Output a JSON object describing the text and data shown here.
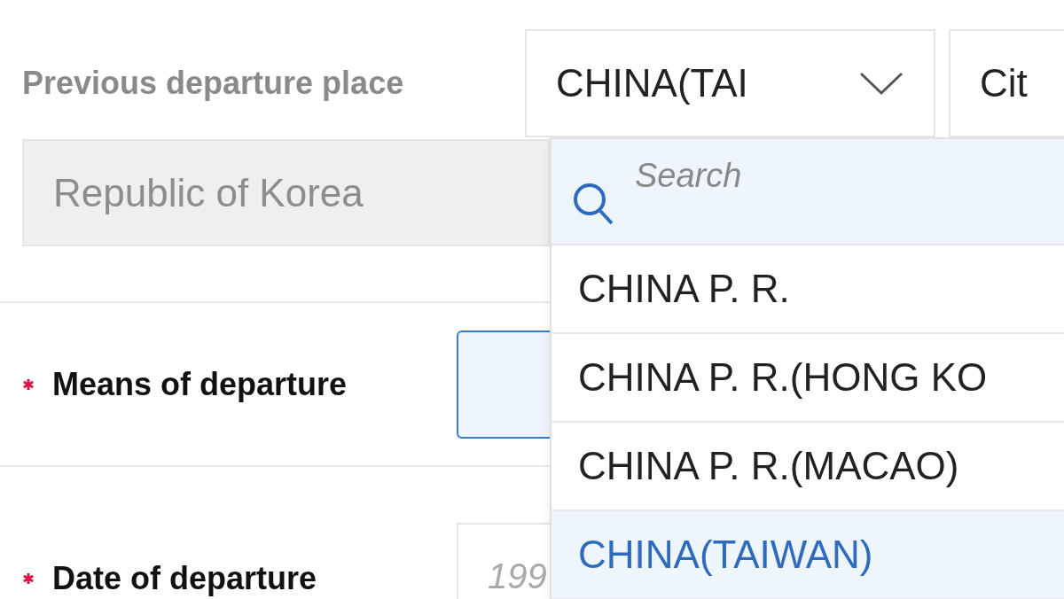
{
  "previous_departure_place": {
    "label": "Previous departure place",
    "country_select": {
      "value": "CHINA(TAI",
      "expanded": true
    },
    "city_select": {
      "value": "Cit"
    },
    "country_field": {
      "value": "Republic of Korea",
      "disabled": true
    }
  },
  "dropdown": {
    "search": {
      "placeholder": "Search"
    },
    "options": [
      {
        "label": "CHINA P. R.",
        "selected": false
      },
      {
        "label": "CHINA P. R.(HONG KO",
        "selected": false
      },
      {
        "label": "CHINA P. R.(MACAO)",
        "selected": false
      },
      {
        "label": "CHINA(TAIWAN)",
        "selected": true
      }
    ]
  },
  "means_of_departure": {
    "label": "Means of departure",
    "required": true,
    "focused": true
  },
  "date_of_departure": {
    "label": "Date of departure",
    "required": true,
    "placeholder": "199"
  }
}
